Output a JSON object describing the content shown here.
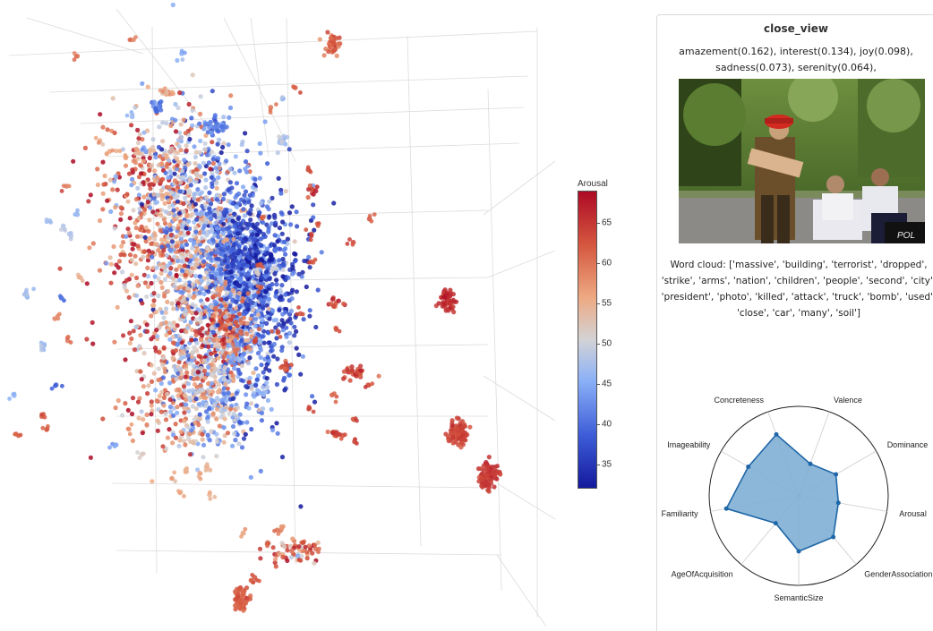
{
  "colors": {
    "low": "#14199c",
    "mid": "#d3d3d6",
    "high": "#ad0a25",
    "radar_fill": "#7fafd4",
    "radar_line": "#1f67a8"
  },
  "chart_data": [
    {
      "type": "scatter",
      "title": "",
      "colorbar": {
        "title": "Arousal",
        "range": [
          32,
          69
        ],
        "ticks": [
          35,
          40,
          45,
          50,
          55,
          60,
          65
        ]
      },
      "clusters": [
        {
          "name": "main-left",
          "x": 0.3,
          "y": 0.41,
          "sx": 0.055,
          "sy": 0.1,
          "n": 1100,
          "arousal": 50,
          "spread": 9
        },
        {
          "name": "main-left-upper",
          "x": 0.26,
          "y": 0.3,
          "sx": 0.05,
          "sy": 0.06,
          "n": 350,
          "arousal": 52,
          "spread": 9
        },
        {
          "name": "main-right",
          "x": 0.39,
          "y": 0.46,
          "sx": 0.04,
          "sy": 0.08,
          "n": 800,
          "arousal": 42,
          "spread": 5
        },
        {
          "name": "main-core-blue",
          "x": 0.37,
          "y": 0.41,
          "sx": 0.025,
          "sy": 0.04,
          "n": 300,
          "arousal": 37,
          "spread": 3
        },
        {
          "name": "main-mid-red",
          "x": 0.35,
          "y": 0.53,
          "sx": 0.022,
          "sy": 0.03,
          "n": 160,
          "arousal": 61,
          "spread": 4
        },
        {
          "name": "main-lower",
          "x": 0.31,
          "y": 0.62,
          "sx": 0.05,
          "sy": 0.05,
          "n": 500,
          "arousal": 51,
          "spread": 7
        },
        {
          "name": "blob-710-480",
          "x": 0.71,
          "y": 0.685,
          "sx": 0.008,
          "sy": 0.01,
          "n": 90,
          "arousal": 64,
          "spread": 1
        },
        {
          "name": "blob-760-530",
          "x": 0.758,
          "y": 0.755,
          "sx": 0.008,
          "sy": 0.01,
          "n": 90,
          "arousal": 65,
          "spread": 1
        },
        {
          "name": "blob-695-335",
          "x": 0.695,
          "y": 0.475,
          "sx": 0.006,
          "sy": 0.008,
          "n": 60,
          "arousal": 66,
          "spread": 1
        },
        {
          "name": "blob-370-670",
          "x": 0.373,
          "y": 0.95,
          "sx": 0.006,
          "sy": 0.01,
          "n": 70,
          "arousal": 62,
          "spread": 1
        },
        {
          "name": "blob-515-50",
          "x": 0.515,
          "y": 0.07,
          "sx": 0.006,
          "sy": 0.008,
          "n": 45,
          "arousal": 61,
          "spread": 2
        },
        {
          "name": "blob-330-140",
          "x": 0.333,
          "y": 0.2,
          "sx": 0.01,
          "sy": 0.006,
          "n": 35,
          "arousal": 42,
          "spread": 2
        },
        {
          "name": "blob-245-120",
          "x": 0.246,
          "y": 0.17,
          "sx": 0.004,
          "sy": 0.006,
          "n": 18,
          "arousal": 42,
          "spread": 2
        },
        {
          "name": "blob-255-105",
          "x": 0.257,
          "y": 0.147,
          "sx": 0.004,
          "sy": 0.004,
          "n": 15,
          "arousal": 55,
          "spread": 2
        },
        {
          "name": "blob-440-150",
          "x": 0.44,
          "y": 0.222,
          "sx": 0.004,
          "sy": 0.004,
          "n": 12,
          "arousal": 47,
          "spread": 2
        },
        {
          "name": "blob-555-415",
          "x": 0.548,
          "y": 0.59,
          "sx": 0.012,
          "sy": 0.005,
          "n": 30,
          "arousal": 63,
          "spread": 3
        },
        {
          "name": "blob-435-610",
          "x": 0.448,
          "y": 0.875,
          "sx": 0.03,
          "sy": 0.01,
          "n": 55,
          "arousal": 60,
          "spread": 6
        },
        {
          "name": "blob-445-410",
          "x": 0.445,
          "y": 0.583,
          "sx": 0.006,
          "sy": 0.004,
          "n": 15,
          "arousal": 63,
          "spread": 2
        },
        {
          "name": "blob-520-490",
          "x": 0.52,
          "y": 0.69,
          "sx": 0.005,
          "sy": 0.004,
          "n": 12,
          "arousal": 64,
          "spread": 2
        },
        {
          "name": "blob-520-340",
          "x": 0.52,
          "y": 0.48,
          "sx": 0.005,
          "sy": 0.005,
          "n": 12,
          "arousal": 63,
          "spread": 2
        },
        {
          "name": "blob-485-210",
          "x": 0.485,
          "y": 0.3,
          "sx": 0.003,
          "sy": 0.004,
          "n": 10,
          "arousal": 65,
          "spread": 2
        }
      ],
      "scatter_points": [
        {
          "x": 0.12,
          "y": 0.089,
          "arousal": 60
        },
        {
          "x": 0.203,
          "y": 0.063,
          "arousal": 59
        },
        {
          "x": 0.282,
          "y": 0.085,
          "arousal": 45
        },
        {
          "x": 0.205,
          "y": 0.185,
          "arousal": 46
        },
        {
          "x": 0.155,
          "y": 0.223,
          "arousal": 56
        },
        {
          "x": 0.438,
          "y": 0.157,
          "arousal": 47
        },
        {
          "x": 0.458,
          "y": 0.139,
          "arousal": 62
        },
        {
          "x": 0.42,
          "y": 0.17,
          "arousal": 60
        },
        {
          "x": 0.478,
          "y": 0.269,
          "arousal": 64
        },
        {
          "x": 0.407,
          "y": 0.346,
          "arousal": 62
        },
        {
          "x": 0.483,
          "y": 0.371,
          "arousal": 64
        },
        {
          "x": 0.493,
          "y": 0.355,
          "arousal": 62
        },
        {
          "x": 0.573,
          "y": 0.347,
          "arousal": 63
        },
        {
          "x": 0.483,
          "y": 0.415,
          "arousal": 63
        },
        {
          "x": 0.402,
          "y": 0.42,
          "arousal": 63
        },
        {
          "x": 0.429,
          "y": 0.426,
          "arousal": 50
        },
        {
          "x": 0.521,
          "y": 0.52,
          "arousal": 62
        },
        {
          "x": 0.548,
          "y": 0.384,
          "arousal": 64
        },
        {
          "x": 0.466,
          "y": 0.497,
          "arousal": 63
        },
        {
          "x": 0.431,
          "y": 0.527,
          "arousal": 63
        },
        {
          "x": 0.406,
          "y": 0.477,
          "arousal": 40
        },
        {
          "x": 0.405,
          "y": 0.443,
          "arousal": 35
        },
        {
          "x": 0.395,
          "y": 0.54,
          "arousal": 64
        },
        {
          "x": 0.571,
          "y": 0.61,
          "arousal": 63
        },
        {
          "x": 0.515,
          "y": 0.626,
          "arousal": 62
        },
        {
          "x": 0.48,
          "y": 0.647,
          "arousal": 64
        },
        {
          "x": 0.407,
          "y": 0.624,
          "arousal": 47
        },
        {
          "x": 0.549,
          "y": 0.665,
          "arousal": 64
        },
        {
          "x": 0.55,
          "y": 0.7,
          "arousal": 64
        },
        {
          "x": 0.532,
          "y": 0.69,
          "arousal": 63
        },
        {
          "x": 0.43,
          "y": 0.84,
          "arousal": 60
        },
        {
          "x": 0.437,
          "y": 0.837,
          "arousal": 58
        },
        {
          "x": 0.395,
          "y": 0.915,
          "arousal": 63
        },
        {
          "x": 0.377,
          "y": 0.845,
          "arousal": 57
        },
        {
          "x": 0.325,
          "y": 0.784,
          "arousal": 55
        },
        {
          "x": 0.28,
          "y": 0.78,
          "arousal": 56
        },
        {
          "x": 0.267,
          "y": 0.758,
          "arousal": 55
        },
        {
          "x": 0.31,
          "y": 0.75,
          "arousal": 56
        },
        {
          "x": 0.065,
          "y": 0.66,
          "arousal": 63
        },
        {
          "x": 0.073,
          "y": 0.68,
          "arousal": 62
        },
        {
          "x": 0.025,
          "y": 0.688,
          "arousal": 62
        },
        {
          "x": 0.022,
          "y": 0.627,
          "arousal": 46
        },
        {
          "x": 0.042,
          "y": 0.47,
          "arousal": 46
        },
        {
          "x": 0.04,
          "y": 0.466,
          "arousal": 47
        },
        {
          "x": 0.065,
          "y": 0.55,
          "arousal": 47
        },
        {
          "x": 0.068,
          "y": 0.548,
          "arousal": 48
        },
        {
          "x": 0.087,
          "y": 0.61,
          "arousal": 38
        },
        {
          "x": 0.095,
          "y": 0.472,
          "arousal": 40
        },
        {
          "x": 0.098,
          "y": 0.358,
          "arousal": 48
        },
        {
          "x": 0.077,
          "y": 0.35,
          "arousal": 47
        },
        {
          "x": 0.105,
          "y": 0.54,
          "arousal": 60
        },
        {
          "x": 0.085,
          "y": 0.505,
          "arousal": 59
        },
        {
          "x": 0.103,
          "y": 0.295,
          "arousal": 60
        },
        {
          "x": 0.12,
          "y": 0.34,
          "arousal": 46
        },
        {
          "x": 0.11,
          "y": 0.374,
          "arousal": 48
        },
        {
          "x": 0.125,
          "y": 0.44,
          "arousal": 55
        },
        {
          "x": 0.195,
          "y": 0.25,
          "arousal": 57
        },
        {
          "x": 0.215,
          "y": 0.242,
          "arousal": 55
        },
        {
          "x": 0.17,
          "y": 0.24,
          "arousal": 56
        },
        {
          "x": 0.27,
          "y": 0.24,
          "arousal": 53
        },
        {
          "x": 0.344,
          "y": 0.457,
          "arousal": 58
        },
        {
          "x": 0.34,
          "y": 0.46,
          "arousal": 57
        },
        {
          "x": 0.36,
          "y": 0.57,
          "arousal": 44
        },
        {
          "x": 0.37,
          "y": 0.57,
          "arousal": 46
        },
        {
          "x": 0.41,
          "y": 0.622,
          "arousal": 46
        },
        {
          "x": 0.3,
          "y": 0.7,
          "arousal": 54
        },
        {
          "x": 0.32,
          "y": 0.74,
          "arousal": 54
        },
        {
          "x": 0.288,
          "y": 0.745,
          "arousal": 55
        },
        {
          "x": 0.47,
          "y": 0.86,
          "arousal": 62
        },
        {
          "x": 0.49,
          "y": 0.87,
          "arousal": 61
        },
        {
          "x": 0.415,
          "y": 0.86,
          "arousal": 61
        },
        {
          "x": 0.39,
          "y": 0.92,
          "arousal": 62
        },
        {
          "x": 0.405,
          "y": 0.455,
          "arousal": 62
        },
        {
          "x": 0.398,
          "y": 0.43,
          "arousal": 50
        },
        {
          "x": 0.352,
          "y": 0.38,
          "arousal": 56
        },
        {
          "x": 0.18,
          "y": 0.705,
          "arousal": 44
        },
        {
          "x": 0.22,
          "y": 0.72,
          "arousal": 52
        },
        {
          "x": 0.2,
          "y": 0.68,
          "arousal": 57
        }
      ]
    },
    {
      "type": "radar",
      "axes": [
        {
          "label": "Valence",
          "value": 0.38
        },
        {
          "label": "Dominance",
          "value": 0.48
        },
        {
          "label": "Arousal",
          "value": 0.45
        },
        {
          "label": "GenderAssociation",
          "value": 0.6
        },
        {
          "label": "SemanticSize",
          "value": 0.62
        },
        {
          "label": "AgeOfAcquisition",
          "value": 0.4
        },
        {
          "label": "Familiarity",
          "value": 0.82
        },
        {
          "label": "Imageability",
          "value": 0.65
        },
        {
          "label": "Concreteness",
          "value": 0.73
        }
      ],
      "range": [
        0,
        1
      ]
    }
  ],
  "panel": {
    "title": "close_view",
    "emotion_line1": "amazement(0.162), interest(0.134), joy(0.098),",
    "emotion_line2": "sadness(0.073), serenity(0.064),",
    "wordcloud": "Word cloud: ['massive', 'building', 'terrorist', 'dropped', 'strike', 'arms', 'nation', 'children', 'people', 'second', 'city', 'president', 'photo', 'killed', 'attack', 'truck', 'bomb', 'used', 'close', 'car', 'many', 'soil']",
    "photo_sign_text": "POL"
  }
}
